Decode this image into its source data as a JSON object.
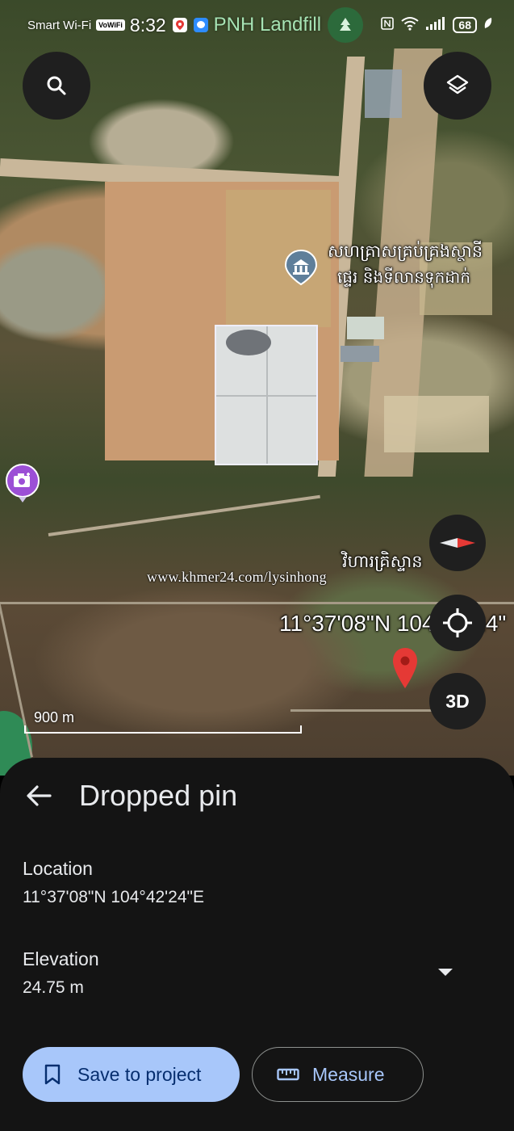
{
  "status_bar": {
    "carrier": "Smart Wi-Fi",
    "vowifi_badge": "VoWiFi",
    "time": "8:32",
    "app_title": "PNH Landfill",
    "battery": "68"
  },
  "map": {
    "poi_label_line1": "សហគ្រាសគ្រប់គ្រងស្ថានី",
    "poi_label_line2": "ផ្ទេរ និងទីលានទុកដាក់",
    "pagoda_label": "វិហារគ្រិស្ទាន",
    "watermark": "www.khmer24.com/lysinhong",
    "coordinate_overlay": "11°37'08\"N 104°42'24\"",
    "scale_label": "900 m",
    "button_3d": "3D"
  },
  "sheet": {
    "title": "Dropped pin",
    "location_label": "Location",
    "location_value": "11°37'08\"N 104°42'24\"E",
    "elevation_label": "Elevation",
    "elevation_value": "24.75 m",
    "save_button": "Save to project",
    "measure_button": "Measure"
  },
  "colors": {
    "sheet_bg": "#141414",
    "primary_button": "#a8c7fa",
    "primary_text": "#062e6f",
    "pin": "#e53935",
    "camera_poi": "#9c4fd6"
  }
}
